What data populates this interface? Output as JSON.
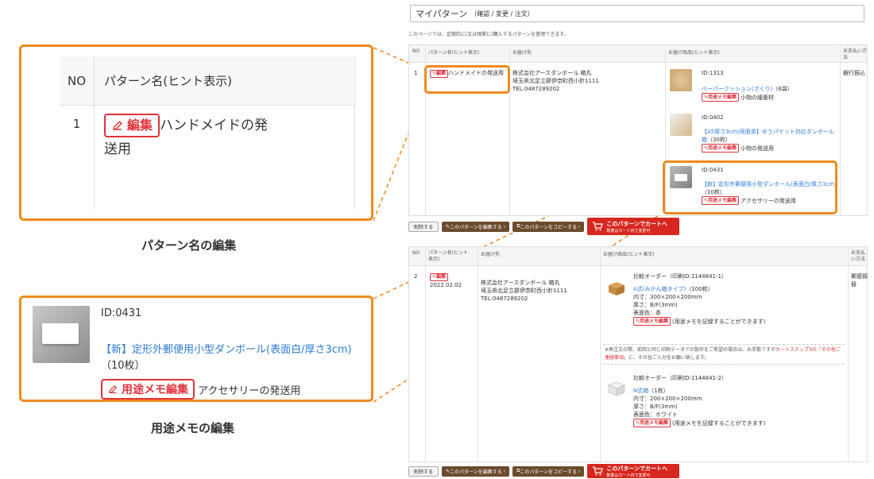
{
  "zoom_name": {
    "col_no": "NO",
    "col_pattern": "パターン名(ヒント表示)",
    "row_no": "1",
    "edit_label": "編集",
    "pattern_name_line1": "ハンドメイドの発",
    "pattern_name_line2": "送用"
  },
  "caption_name": "パターン名の編集",
  "zoom_memo": {
    "id": "ID:0431",
    "product_link": "【新】定形外郵便用小型ダンボール(表面白/厚さ3cm)",
    "product_qty": "（10枚）",
    "memo_button": "用途メモ編集",
    "memo_text": "アクセサリーの発送用"
  },
  "caption_memo": "用途メモの編集",
  "screen": {
    "title": "マイパターン",
    "title_sub": "（確認 / 変更 / 注文）",
    "intro": "このページでは、定期的に(又は頻繁に)購入するパターンを管理できます。",
    "headers": {
      "no": "NO",
      "pattern": "パターン名(ヒント表示)",
      "pattern_wrap1": "パターン名(ヒント",
      "pattern_wrap2": "表示)",
      "dest": "お届け先",
      "products": "お届け商品(ヒント表示)",
      "pay": "お支払い方法",
      "pay_wrap1": "お支払",
      "pay_wrap2": "い方法"
    },
    "row1": {
      "no": "1",
      "edit": "編集",
      "name": "ハンドメイドの発送用",
      "dest_name": "株式会社アースダンボール 箱丸",
      "dest_addr": "埼玉県北足立郡伊奈町西小針1111",
      "dest_tel": "TEL:0487289202",
      "pay": "銀行振込",
      "items": [
        {
          "id": "ID:1313",
          "link": "ペーパークッション(ざくり)",
          "qty": "（6袋）",
          "memo_btn": "用途メモ編集",
          "memo": "小物の緩衝材"
        },
        {
          "id": "ID:0402",
          "link": "【A5厚さ3cm/両面茶】ゆうパケット対応ダンボール箱",
          "qty": "（30枚）",
          "memo_btn": "用途メモ編集",
          "memo": "小物の発送用"
        },
        {
          "id": "ID:0431",
          "link": "【新】定形外郵便用小型ダンボール(表面白/厚さ3cm)",
          "qty": "（10枚）",
          "memo_btn": "用途メモ編集",
          "memo": "アクセサリーの発送用"
        }
      ]
    },
    "row2": {
      "no": "2",
      "edit": "編集",
      "date": "2022.02.02",
      "dest_name": "株式会社アースダンボール 箱丸",
      "dest_addr": "埼玉県北足立郡伊奈町西小針1111",
      "dest_tel": "TEL:0487289202",
      "pay": "郵便振替",
      "item1": {
        "title": "比較オーダー（印刷ID:1144841-1）",
        "link": "A式(みかん箱タイプ)",
        "qty": "（100枚）",
        "size": "内寸：300×200×200mm",
        "thick": "厚さ：B/F(3mm)",
        "color": "表面色：茶",
        "memo_btn": "用途メモ編集",
        "memo": "(用途メモを記録することができます)"
      },
      "note_1": "※再注文の際、前回と同じ印刷データでの製作をご希望の場合は、お手数ですが",
      "note_link": "カートステップ3の「その他ご連絡事項」",
      "note_2": "に、その旨ご入力をお願い致します。",
      "item2": {
        "title": "比較オーダー（印刷ID:1144841-2）",
        "link": "N式箱",
        "qty": "（1枚）",
        "size": "内寸：200×200×200mm",
        "thick": "厚さ：B/F(3mm)",
        "color": "表面色：ホワイト",
        "memo_btn": "用途メモ編集",
        "memo": "(用途メモを記録することができます)"
      }
    },
    "buttons": {
      "delete": "削除する",
      "edit_pattern": "このパターンを編集する",
      "copy_pattern": "このパターンをコピーする",
      "cart_main": "このパターンでカートへ",
      "cart_sub": "数量はカート内で変更可"
    }
  },
  "colors": {
    "accent": "#ef8a1f",
    "edit_red": "#e0333a",
    "link_blue": "#2f7bd6",
    "brown": "#6b4b2d",
    "cart_red": "#d7281f"
  }
}
